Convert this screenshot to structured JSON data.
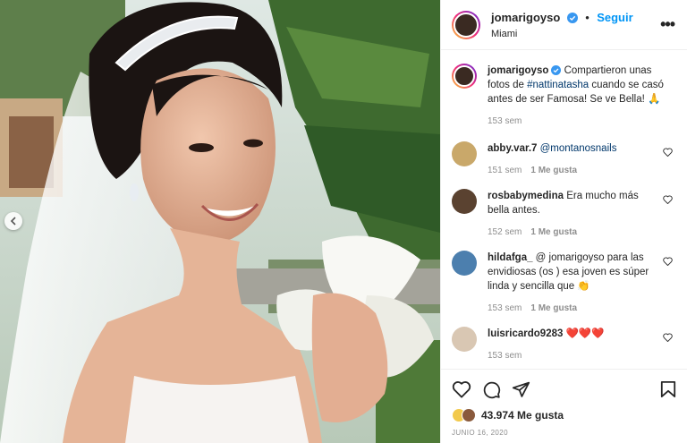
{
  "post": {
    "author": "jomarigoyso",
    "separator": "•",
    "follow_label": "Seguir",
    "location": "Miami",
    "more_label": "•••"
  },
  "caption": {
    "author": "jomarigoyso",
    "text_before": " Compartieron unas fotos de ",
    "hashtag": "#nattinatasha",
    "text_after": " cuando se casó antes de ser Famosa! Se ve Bella! 🙏",
    "time": "153 sem"
  },
  "comments": [
    {
      "user": "abby.var.7",
      "mention": "@montanosnails",
      "text": "",
      "time": "151 sem",
      "likes": "1 Me gusta"
    },
    {
      "user": "rosbabymedina",
      "mention": "",
      "text": " Era mucho más bella antes.",
      "time": "152 sem",
      "likes": "1 Me gusta"
    },
    {
      "user": "hildafga_",
      "mention": "",
      "text": " @ jomarigoyso para las envidiosas (os ) esa joven es súper linda y sencilla que 👏",
      "time": "153 sem",
      "likes": "1 Me gusta"
    },
    {
      "user": "luisricardo9283",
      "mention": "",
      "text": " ❤️❤️❤️",
      "time": "153 sem",
      "likes": ""
    }
  ],
  "stats": {
    "likes": "43.974 Me gusta",
    "date": "JUNIO 16, 2020"
  },
  "colors": {
    "accent": "#0095f6",
    "verified": "#3897f0",
    "text": "#262626",
    "muted": "#8e8e8e"
  },
  "icons": [
    "heart-icon",
    "comment-icon",
    "share-icon",
    "bookmark-icon",
    "verified-icon",
    "chevron-left-icon",
    "more-icon"
  ]
}
